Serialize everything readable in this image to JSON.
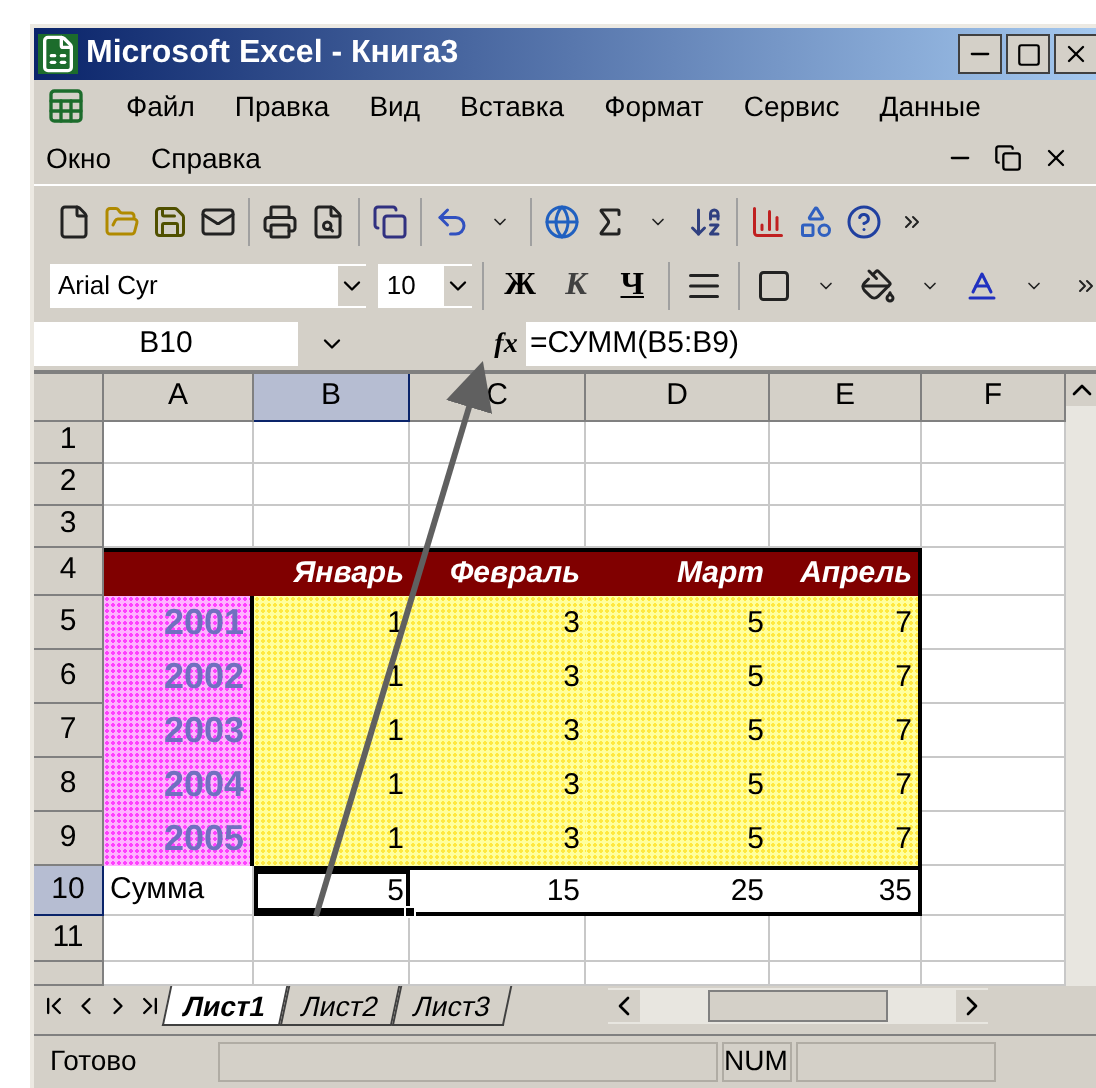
{
  "window": {
    "title": "Microsoft Excel - Книга3"
  },
  "menu_rows": [
    [
      {
        "label": "Файл"
      },
      {
        "label": "Правка"
      },
      {
        "label": "Вид"
      },
      {
        "label": "Вставка"
      },
      {
        "label": "Формат"
      },
      {
        "label": "Сервис"
      },
      {
        "label": "Данные"
      }
    ],
    [
      {
        "label": "Окно"
      },
      {
        "label": "Справка"
      }
    ]
  ],
  "formatting": {
    "font": "Arial Cyr",
    "size": "10",
    "bold": "Ж",
    "italic": "К",
    "underline": "Ч"
  },
  "formula_bar": {
    "name_box": "B10",
    "fx": "fx",
    "formula": "=СУММ(B5:B9)"
  },
  "sheet": {
    "columns": [
      {
        "label": "A",
        "selected": false
      },
      {
        "label": "B",
        "selected": true
      },
      {
        "label": "C",
        "selected": false
      },
      {
        "label": "D",
        "selected": false
      },
      {
        "label": "E",
        "selected": false
      },
      {
        "label": "F",
        "selected": false
      }
    ],
    "rows": [
      {
        "label": "1",
        "selected": false,
        "cells": [
          {
            "kind": "plain"
          },
          {
            "kind": "plain"
          },
          {
            "kind": "plain"
          },
          {
            "kind": "plain"
          },
          {
            "kind": "plain"
          },
          {
            "kind": "plain"
          }
        ]
      },
      {
        "label": "2",
        "selected": false,
        "cells": [
          {
            "kind": "plain"
          },
          {
            "kind": "plain"
          },
          {
            "kind": "plain"
          },
          {
            "kind": "plain"
          },
          {
            "kind": "plain"
          },
          {
            "kind": "plain"
          }
        ]
      },
      {
        "label": "3",
        "selected": false,
        "cells": [
          {
            "kind": "plain"
          },
          {
            "kind": "plain"
          },
          {
            "kind": "plain"
          },
          {
            "kind": "plain"
          },
          {
            "kind": "plain"
          },
          {
            "kind": "plain"
          }
        ]
      },
      {
        "label": "4",
        "selected": false,
        "cells": [
          {
            "kind": "header"
          },
          {
            "kind": "header",
            "text": "Январь"
          },
          {
            "kind": "header",
            "text": "Февраль"
          },
          {
            "kind": "header",
            "text": "Март"
          },
          {
            "kind": "header",
            "text": "Апрель"
          },
          {
            "kind": "plain"
          }
        ]
      },
      {
        "label": "5",
        "selected": false,
        "cells": [
          {
            "kind": "year",
            "text": "2001"
          },
          {
            "kind": "data",
            "text": "1"
          },
          {
            "kind": "data",
            "text": "3"
          },
          {
            "kind": "data",
            "text": "5"
          },
          {
            "kind": "data",
            "text": "7"
          },
          {
            "kind": "plain"
          }
        ]
      },
      {
        "label": "6",
        "selected": false,
        "cells": [
          {
            "kind": "year",
            "text": "2002"
          },
          {
            "kind": "data",
            "text": "1"
          },
          {
            "kind": "data",
            "text": "3"
          },
          {
            "kind": "data",
            "text": "5"
          },
          {
            "kind": "data",
            "text": "7"
          },
          {
            "kind": "plain"
          }
        ]
      },
      {
        "label": "7",
        "selected": false,
        "cells": [
          {
            "kind": "year",
            "text": "2003"
          },
          {
            "kind": "data",
            "text": "1"
          },
          {
            "kind": "data",
            "text": "3"
          },
          {
            "kind": "data",
            "text": "5"
          },
          {
            "kind": "data",
            "text": "7"
          },
          {
            "kind": "plain"
          }
        ]
      },
      {
        "label": "8",
        "selected": false,
        "cells": [
          {
            "kind": "year",
            "text": "2004"
          },
          {
            "kind": "data",
            "text": "1"
          },
          {
            "kind": "data",
            "text": "3"
          },
          {
            "kind": "data",
            "text": "5"
          },
          {
            "kind": "data",
            "text": "7"
          },
          {
            "kind": "plain"
          }
        ]
      },
      {
        "label": "9",
        "selected": false,
        "cells": [
          {
            "kind": "year",
            "text": "2005"
          },
          {
            "kind": "data",
            "text": "1"
          },
          {
            "kind": "data",
            "text": "3"
          },
          {
            "kind": "data",
            "text": "5"
          },
          {
            "kind": "data",
            "text": "7"
          },
          {
            "kind": "plain"
          }
        ]
      },
      {
        "label": "10",
        "selected": true,
        "cells": [
          {
            "kind": "plain",
            "text": "Сумма"
          },
          {
            "kind": "sum",
            "text": "5",
            "active": true
          },
          {
            "kind": "sum",
            "text": "15"
          },
          {
            "kind": "sum",
            "text": "25"
          },
          {
            "kind": "sum",
            "text": "35"
          },
          {
            "kind": "plain"
          }
        ]
      },
      {
        "label": "11",
        "selected": false,
        "cells": [
          {
            "kind": "plain"
          },
          {
            "kind": "plain"
          },
          {
            "kind": "plain"
          },
          {
            "kind": "plain"
          },
          {
            "kind": "plain"
          },
          {
            "kind": "plain"
          }
        ]
      },
      {
        "selected": false,
        "cells": [
          {
            "kind": "plain"
          },
          {
            "kind": "plain"
          },
          {
            "kind": "plain"
          },
          {
            "kind": "plain"
          },
          {
            "kind": "plain"
          },
          {
            "kind": "plain"
          }
        ]
      }
    ]
  },
  "sheet_tabs": [
    {
      "label": "Лист1",
      "selected": true
    },
    {
      "label": "Лист2",
      "selected": false
    },
    {
      "label": "Лист3",
      "selected": false
    }
  ],
  "status_bar": {
    "status": "Готово",
    "indicator": "NUM"
  }
}
